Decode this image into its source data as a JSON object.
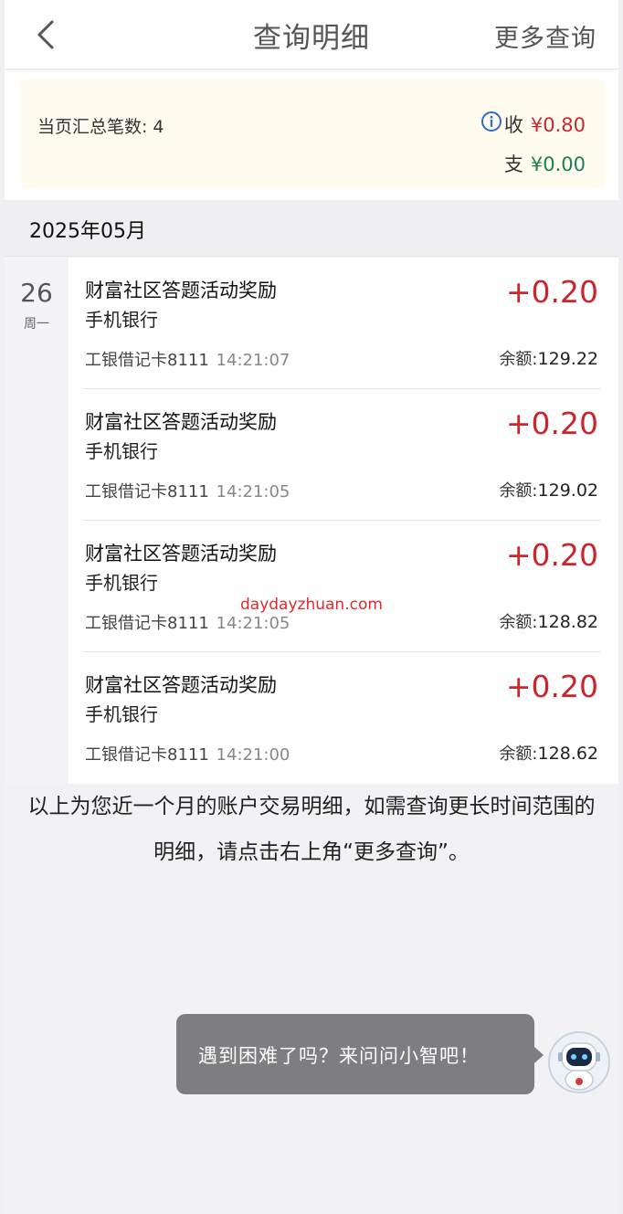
{
  "header": {
    "title": "查询明细",
    "more_label": "更多查询"
  },
  "summary": {
    "count_label": "当页汇总笔数:",
    "count_value": "4",
    "income_label": "收",
    "income_amount": "¥0.80",
    "expense_label": "支",
    "expense_amount": "¥0.00"
  },
  "month": "2025年05月",
  "date_group": {
    "day": "26",
    "weekday": "周一"
  },
  "transactions": [
    {
      "title": "财富社区答题活动奖励",
      "channel": "手机银行",
      "amount": "+0.20",
      "card": "工银借记卡8111",
      "time": "14:21:07",
      "balance_label": "余额:",
      "balance": "129.22"
    },
    {
      "title": "财富社区答题活动奖励",
      "channel": "手机银行",
      "amount": "+0.20",
      "card": "工银借记卡8111",
      "time": "14:21:05",
      "balance_label": "余额:",
      "balance": "129.02"
    },
    {
      "title": "财富社区答题活动奖励",
      "channel": "手机银行",
      "amount": "+0.20",
      "card": "工银借记卡8111",
      "time": "14:21:05",
      "balance_label": "余额:",
      "balance": "128.82"
    },
    {
      "title": "财富社区答题活动奖励",
      "channel": "手机银行",
      "amount": "+0.20",
      "card": "工银借记卡8111",
      "time": "14:21:00",
      "balance_label": "余额:",
      "balance": "128.62"
    }
  ],
  "watermark": "daydayzhuan.com",
  "footer_note": "以上为您近一个月的账户交易明细，如需查询更长时间范围的明细，请点击右上角“更多查询”。",
  "assistant_tip": "遇到困难了吗？来问问小智吧！",
  "colors": {
    "income": "#c8282d",
    "expense": "#1d7d55",
    "summary_bg": "#fffbef",
    "tip_bg": "#7e7e80"
  },
  "icons": [
    "back-chevron-icon",
    "info-icon",
    "assistant-robot-icon"
  ]
}
